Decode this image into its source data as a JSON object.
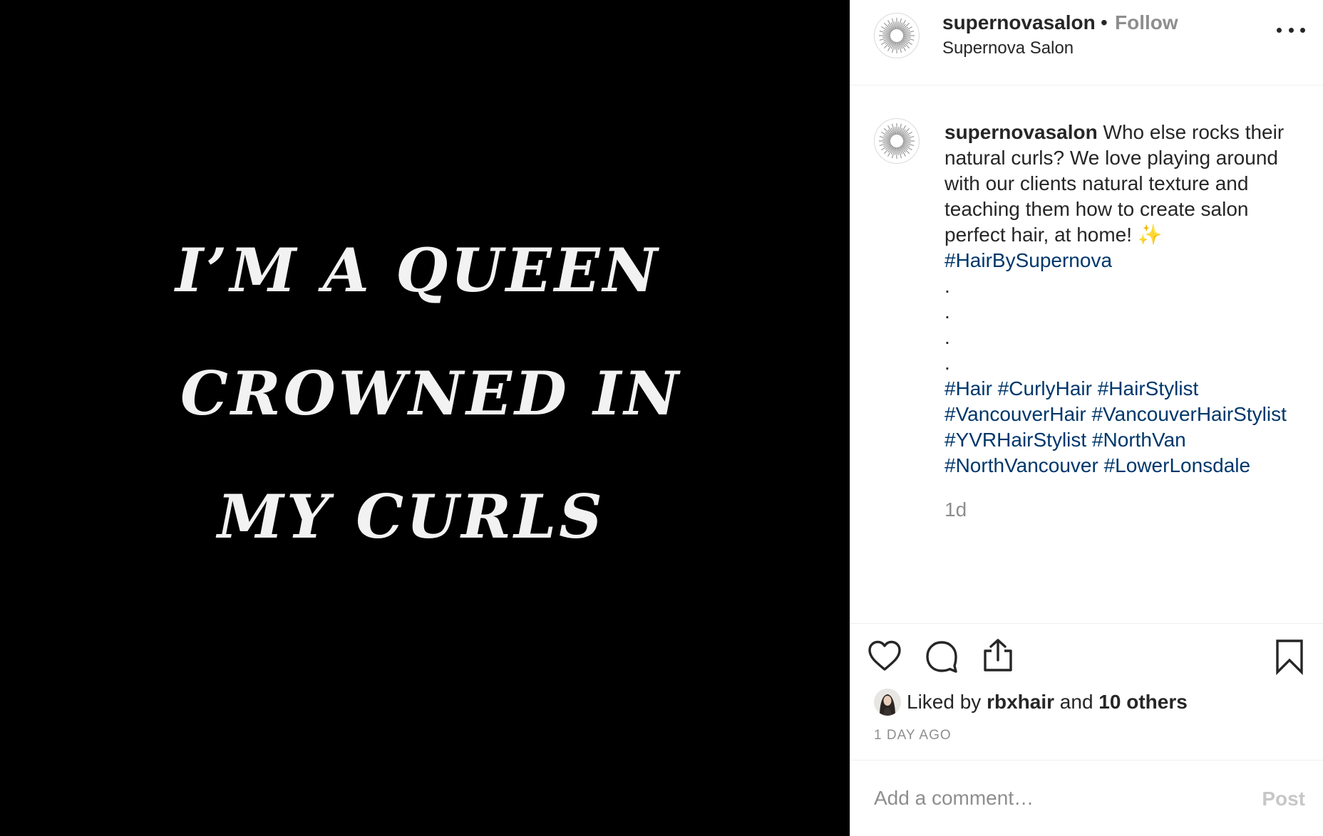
{
  "image": {
    "quote_lines": [
      "I’M A QUEEN",
      "CROWNED IN",
      "MY CURLS"
    ]
  },
  "header": {
    "username": "supernovasalon",
    "separator": "•",
    "follow_label": "Follow",
    "subtitle": "Supernova Salon"
  },
  "caption": {
    "username": "supernovasalon",
    "text": "Who else rocks their natural curls? We love playing around with our clients natural texture and teaching them how to create salon perfect hair, at home!",
    "sparkle": "✨",
    "first_hashtag": "#HairBySupernova",
    "dots": [
      ".",
      ".",
      ".",
      "."
    ],
    "hashtags": [
      "#Hair",
      "#CurlyHair",
      "#HairStylist",
      "#VancouverHair",
      "#VancouverHairStylist",
      "#YVRHairStylist",
      "#NorthVan",
      "#NorthVancouver",
      "#LowerLonsdale"
    ],
    "time_ago": "1d"
  },
  "actions": {
    "liked_prefix": "Liked by",
    "liked_user": "rbxhair",
    "liked_and": "and",
    "liked_others": "10 others",
    "timestamp": "1 DAY AGO"
  },
  "comment": {
    "placeholder": "Add a comment…",
    "post_label": "Post"
  },
  "colors": {
    "hashtag": "#00376b",
    "muted": "#8e8e8e",
    "text": "#262626"
  },
  "icons": [
    "more-icon",
    "heart-icon",
    "comment-icon",
    "share-icon",
    "bookmark-icon"
  ]
}
